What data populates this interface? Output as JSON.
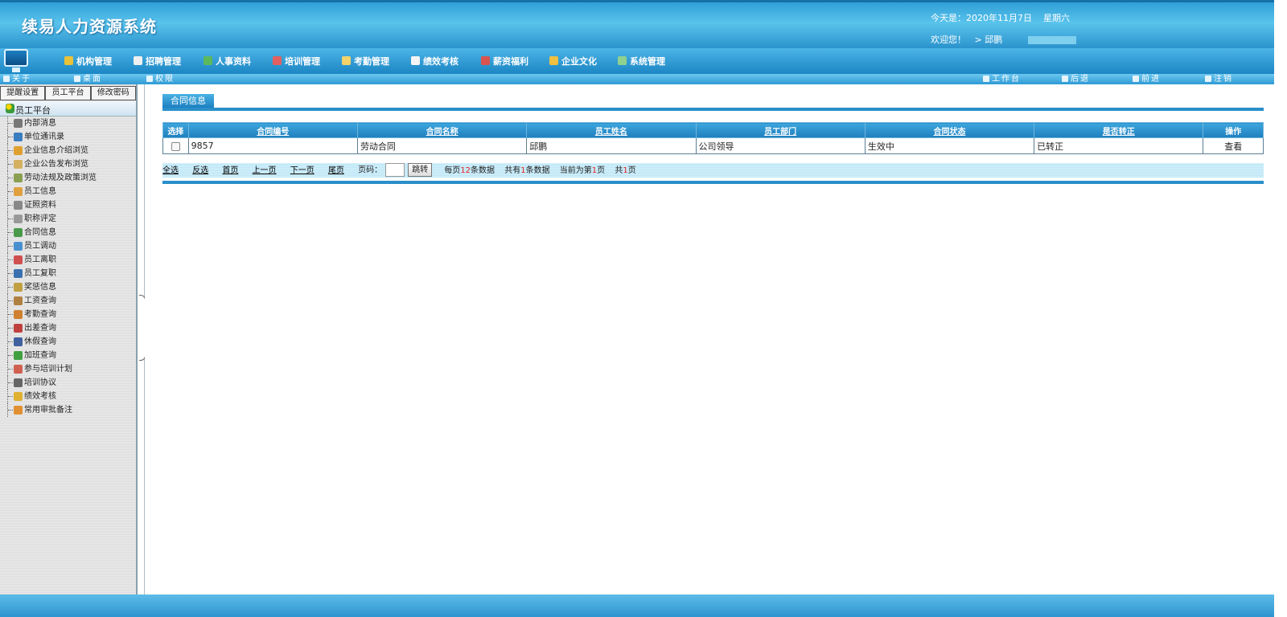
{
  "header": {
    "app_title": "续易人力资源系统",
    "date_label": "今天是：2020年11月7日",
    "weekday": "星期六",
    "welcome": "欢迎您！",
    "user": "> 邱鹏"
  },
  "nav": {
    "items": [
      {
        "label": "机构管理",
        "icon": "org-icon",
        "color": "#e8c23a"
      },
      {
        "label": "招聘管理",
        "icon": "recruit-icon",
        "color": "#f0f0f0"
      },
      {
        "label": "人事资料",
        "icon": "personnel-icon",
        "color": "#5cb85c"
      },
      {
        "label": "培训管理",
        "icon": "training-icon",
        "color": "#e26060"
      },
      {
        "label": "考勤管理",
        "icon": "attendance-icon",
        "color": "#f3d36a"
      },
      {
        "label": "绩效考核",
        "icon": "performance-icon",
        "color": "#f5f5f5"
      },
      {
        "label": "薪资福利",
        "icon": "salary-icon",
        "color": "#d9534f"
      },
      {
        "label": "企业文化",
        "icon": "culture-icon",
        "color": "#f0c040"
      },
      {
        "label": "系统管理",
        "icon": "system-icon",
        "color": "#8fd18f"
      }
    ]
  },
  "toolbar": {
    "about": "关于",
    "desktop": "桌面",
    "permission": "权限",
    "workbench": "工作台",
    "back": "后退",
    "forward": "前进",
    "logout": "注销"
  },
  "sidebar": {
    "tabs": [
      "提醒设置",
      "员工平台",
      "修改密码"
    ],
    "root": "员工平台",
    "items": [
      {
        "label": "内部消息",
        "icon": "message-icon",
        "color": "#777"
      },
      {
        "label": "单位通讯录",
        "icon": "contacts-icon",
        "color": "#3a7dc0"
      },
      {
        "label": "企业信息介绍浏览",
        "icon": "edit-icon",
        "color": "#e0a030"
      },
      {
        "label": "企业公告发布浏览",
        "icon": "notice-icon",
        "color": "#d4b060"
      },
      {
        "label": "劳动法规及政策浏览",
        "icon": "law-icon",
        "color": "#8aa050"
      },
      {
        "label": "员工信息",
        "icon": "employee-icon",
        "color": "#e0a040"
      },
      {
        "label": "证照资料",
        "icon": "certificate-icon",
        "color": "#888"
      },
      {
        "label": "职称评定",
        "icon": "title-icon",
        "color": "#999"
      },
      {
        "label": "合同信息",
        "icon": "contract-icon",
        "color": "#4a9a4a"
      },
      {
        "label": "员工调动",
        "icon": "transfer-icon",
        "color": "#4a90d0"
      },
      {
        "label": "员工离职",
        "icon": "resign-icon",
        "color": "#d05050"
      },
      {
        "label": "员工复职",
        "icon": "reinstate-icon",
        "color": "#3a70b0"
      },
      {
        "label": "奖惩信息",
        "icon": "reward-icon",
        "color": "#c0a040"
      },
      {
        "label": "工资查询",
        "icon": "salary-query-icon",
        "color": "#b08040"
      },
      {
        "label": "考勤查询",
        "icon": "attendance-query-icon",
        "color": "#d08030"
      },
      {
        "label": "出差查询",
        "icon": "trip-icon",
        "color": "#c04040"
      },
      {
        "label": "休假查询",
        "icon": "leave-icon",
        "color": "#4060a0"
      },
      {
        "label": "加班查询",
        "icon": "overtime-icon",
        "color": "#40a040"
      },
      {
        "label": "参与培训计划",
        "icon": "training-plan-icon",
        "color": "#d06050"
      },
      {
        "label": "培训协议",
        "icon": "agreement-icon",
        "color": "#666"
      },
      {
        "label": "绩效考核",
        "icon": "kpi-icon",
        "color": "#e0b030"
      },
      {
        "label": "常用审批备注",
        "icon": "approval-icon",
        "color": "#e09030"
      }
    ]
  },
  "main": {
    "section_title": "合同信息",
    "columns": [
      "选择",
      "合同编号",
      "合同名称",
      "员工姓名",
      "员工部门",
      "合同状态",
      "是否转正",
      "操作"
    ],
    "rows": [
      {
        "code": "9857",
        "name": "劳动合同",
        "employee": "邱鹏",
        "dept": "公司领导",
        "status": "生效中",
        "regular": "已转正",
        "action": "查看"
      }
    ],
    "pager": {
      "select_all": "全选",
      "invert": "反选",
      "first": "首页",
      "prev": "上一页",
      "next": "下一页",
      "last": "尾页",
      "page_label": "页码：",
      "jump": "跳转",
      "per_page_prefix": "每页",
      "per_page": "12",
      "per_page_suffix": "条数据",
      "total_prefix": "共有",
      "total": "1",
      "total_suffix": "条数据",
      "current_prefix": "当前为第",
      "current": "1",
      "current_suffix": "页",
      "pages_prefix": "共",
      "pages": "1",
      "pages_suffix": "页"
    }
  },
  "colors": {
    "header_blue": "#3aaee4",
    "accent": "#2a8fca",
    "count_red": "#e02020"
  }
}
